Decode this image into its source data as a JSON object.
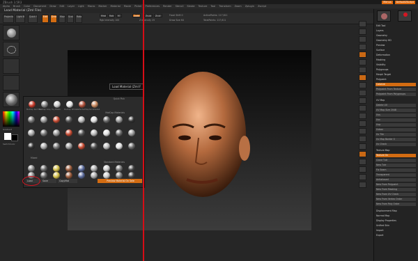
{
  "titlebar": {
    "app": "ZBrush 3.5R3",
    "menu_right_badge": "Menus",
    "default_script": "DefaultZScript"
  },
  "menubar": [
    "Alpha",
    "Brush",
    "Color",
    "Document",
    "Draw",
    "Edit",
    "Layer",
    "Light",
    "Macro",
    "Marker",
    "Material",
    "Movie",
    "Picker",
    "Preferences",
    "Render",
    "Stencil",
    "Stroke",
    "Texture",
    "Tool",
    "Transform",
    "Zoom",
    "Zplugin",
    "Zscript"
  ],
  "document_title": "Lead Material (ZmI File)",
  "toolbar": {
    "projection": "Projection Master",
    "lightbox": "Light Box",
    "quick_sketch": "Quick Sketch",
    "edit": "Edit",
    "draw": "Draw",
    "move": "Move",
    "scale": "Scale",
    "rotate": "Rotate",
    "mrgb": "Mrgb",
    "rgb": "Rgb",
    "m": "M",
    "zadd": "Zadd",
    "zsub": "Zsub",
    "zcut": "Zcut",
    "rgb_intensity": "Rgb Intensity 100",
    "z_intensity": "Z Intensity 25",
    "focal_shift": "Focal Shift 0",
    "draw_size": "Draw Size 64",
    "active_points": "ActivePoints: 117,611",
    "total_points": "TotalPoints: 117,611"
  },
  "tooltip": "Load Material (ZmI F",
  "material_panel": {
    "section_quick": "Quick Pick",
    "section_matcap": "MatCap Materials",
    "section_mixed": "Mixed",
    "section_standard": "Standard Materials",
    "quick_row": [
      "MatCap Red Wax",
      "MatCap Gray",
      "Toy Plastic",
      "MatCap White",
      "ReflectedMap",
      "SkinShade4"
    ],
    "load": "Load",
    "save": "Save",
    "copy_mat": "CopyMat",
    "preview": "Preview Material On Sele"
  },
  "right_panel": {
    "items_top": [
      "Edit Tool",
      "Layers",
      "Geometry",
      "Geometry HD",
      "Preview",
      "Surface",
      "Deformation",
      "Masking",
      "Visibility",
      "Polygroups",
      "Morph Target",
      "Polypaint"
    ],
    "polypaint_sub": [
      "Colorize",
      "Polypaint From Texture",
      "Polypaint From Polygroups"
    ],
    "uvmap": "UV Map",
    "uv_sub": [
      "Delete UV",
      "UV Map Size 2048",
      "Uvs",
      "Uvc",
      "Uvp",
      "Uvbox",
      "Uv Tile",
      "Uv Map Border 0",
      "Uv Check"
    ],
    "texture_map": "Texture Map",
    "texmap_sub": [
      "Texture On",
      "Clone Txtr",
      "New Txtr",
      "Fix Seam",
      "Transparent",
      "Antialiased",
      "New From Polypaint",
      "New From Masking",
      "New From UV Check",
      "New From Vertex Order",
      "New From Poly Order"
    ],
    "items_bottom": [
      "Displacement Map",
      "Normal Map",
      "Display Properties",
      "Unified Skin",
      "Import",
      "Export"
    ]
  },
  "colors": {
    "accent": "#d36c12",
    "red_line": "#d70d16",
    "background": "#262626"
  }
}
